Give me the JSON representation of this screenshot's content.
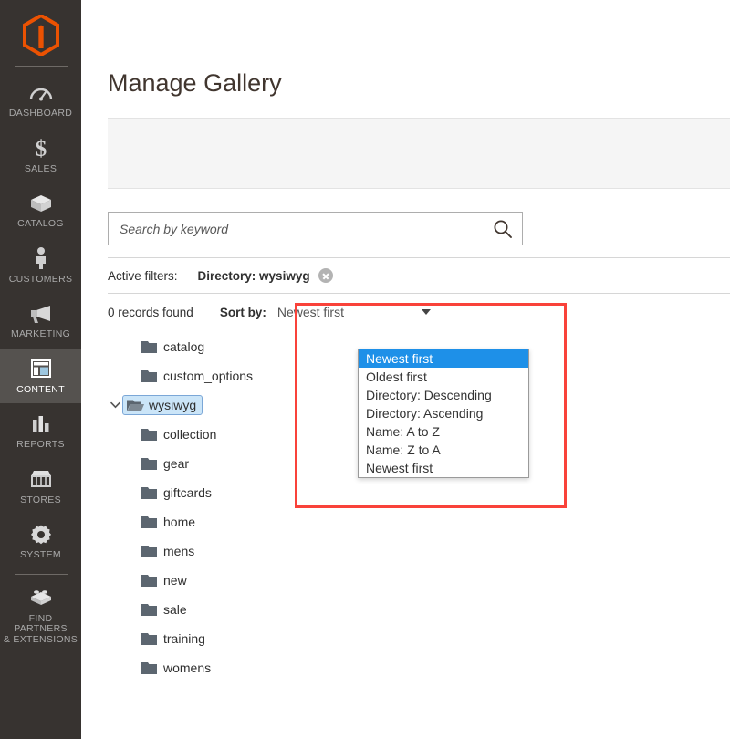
{
  "sidebar": {
    "logo_name": "magento-logo",
    "items": [
      {
        "label": "Dashboard",
        "icon": "dashboard-icon",
        "active": false
      },
      {
        "label": "Sales",
        "icon": "dollar-icon",
        "active": false
      },
      {
        "label": "Catalog",
        "icon": "box-icon",
        "active": false
      },
      {
        "label": "Customers",
        "icon": "person-icon",
        "active": false
      },
      {
        "label": "Marketing",
        "icon": "megaphone-icon",
        "active": false
      },
      {
        "label": "Content",
        "icon": "layout-icon",
        "active": true
      },
      {
        "label": "Reports",
        "icon": "bar-chart-icon",
        "active": false
      },
      {
        "label": "Stores",
        "icon": "storefront-icon",
        "active": false
      },
      {
        "label": "System",
        "icon": "gear-icon",
        "active": false
      },
      {
        "label": "Find Partners\n& Extensions",
        "icon": "lego-brick-icon",
        "active": false
      }
    ],
    "find_partners_line1": "Find Partners",
    "find_partners_line2": "& Extensions"
  },
  "page": {
    "title": "Manage Gallery"
  },
  "search": {
    "placeholder": "Search by keyword",
    "value": "",
    "icon": "search-icon"
  },
  "filters": {
    "label": "Active filters:",
    "chips": [
      {
        "text": "Directory: wysiwyg",
        "remove_icon": "close-circle-icon"
      }
    ]
  },
  "grid": {
    "records_found": "0 records found",
    "sort": {
      "label": "Sort by:",
      "selected": "Newest first",
      "caret_icon": "chevron-down-icon",
      "open": true,
      "options": [
        "Newest first",
        "Oldest first",
        "Directory: Descending",
        "Directory: Ascending",
        "Name: A to Z",
        "Name: Z to A",
        "Newest first"
      ],
      "highlighted_index": 0
    }
  },
  "tree": {
    "nodes": [
      {
        "label": "catalog",
        "level": 1,
        "selected": false,
        "expanded": false,
        "open_folder": false
      },
      {
        "label": "custom_options",
        "level": 1,
        "selected": false,
        "expanded": false,
        "open_folder": false
      },
      {
        "label": "wysiwyg",
        "level": 1,
        "selected": true,
        "expanded": true,
        "open_folder": true
      },
      {
        "label": "collection",
        "level": 2,
        "selected": false,
        "expanded": false,
        "open_folder": false
      },
      {
        "label": "gear",
        "level": 2,
        "selected": false,
        "expanded": false,
        "open_folder": false
      },
      {
        "label": "giftcards",
        "level": 2,
        "selected": false,
        "expanded": false,
        "open_folder": false
      },
      {
        "label": "home",
        "level": 2,
        "selected": false,
        "expanded": false,
        "open_folder": false
      },
      {
        "label": "mens",
        "level": 2,
        "selected": false,
        "expanded": false,
        "open_folder": false
      },
      {
        "label": "new",
        "level": 2,
        "selected": false,
        "expanded": false,
        "open_folder": false
      },
      {
        "label": "sale",
        "level": 2,
        "selected": false,
        "expanded": false,
        "open_folder": false
      },
      {
        "label": "training",
        "level": 2,
        "selected": false,
        "expanded": false,
        "open_folder": false
      },
      {
        "label": "womens",
        "level": 2,
        "selected": false,
        "expanded": false,
        "open_folder": false
      }
    ]
  },
  "annotation": {
    "name": "red-highlight-rectangle",
    "color": "#f9423a"
  },
  "colors": {
    "sidebar_bg": "#373330",
    "sidebar_active_bg": "#55524f",
    "brand_orange": "#eb5202",
    "dropdown_highlight": "#1e90e8",
    "tree_selected_bg": "#cbe5f8",
    "annotation_red": "#f9423a"
  }
}
